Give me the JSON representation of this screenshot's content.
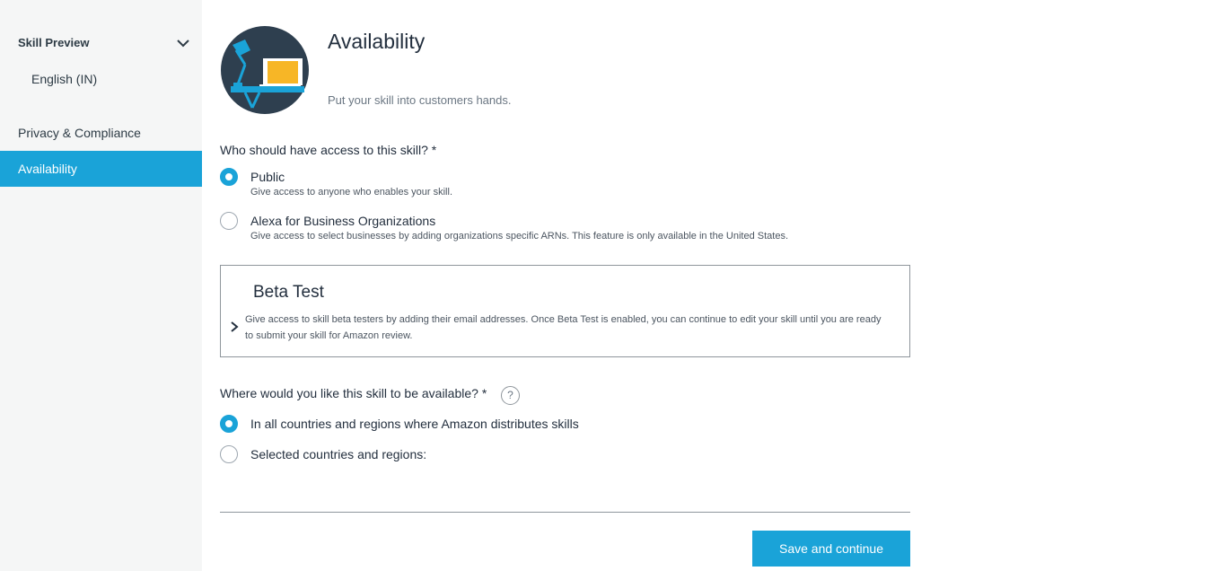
{
  "sidebar": {
    "section_title": "Skill Preview",
    "section_icon": "chevron-down-icon",
    "sub_item": "English (IN)",
    "privacy_item": "Privacy & Compliance",
    "active_item": "Availability"
  },
  "header": {
    "title": "Availability",
    "subtitle": "Put your skill into customers hands.",
    "hero_icon": "desk-lamp-laptop-illustration"
  },
  "access": {
    "question": "Who should have access to this skill? *",
    "options": [
      {
        "label": "Public",
        "description": "Give access to anyone who enables your skill.",
        "selected": true
      },
      {
        "label": "Alexa for Business Organizations",
        "description": "Give access to select businesses by adding organizations specific ARNs. This feature is only available in the United States.",
        "selected": false
      }
    ]
  },
  "beta": {
    "title": "Beta Test",
    "description": "Give access to skill beta testers by adding their email addresses. Once Beta Test is enabled, you can continue to edit your skill until you are ready to submit your skill for Amazon review.",
    "icon": "chevron-right-icon"
  },
  "availability": {
    "question": "Where would you like this skill to be available?  *",
    "help_label": "?",
    "options": [
      {
        "label": "In all countries and regions where Amazon distributes skills",
        "selected": true
      },
      {
        "label": "Selected countries and regions:",
        "selected": false
      }
    ]
  },
  "footer": {
    "save_label": "Save and continue"
  },
  "colors": {
    "accent": "#1aa3d8",
    "sidebar_bg": "#f5f6f6",
    "text": "#232f3e",
    "hero_bg": "#2e3f4f",
    "laptop": "#f7b626"
  }
}
